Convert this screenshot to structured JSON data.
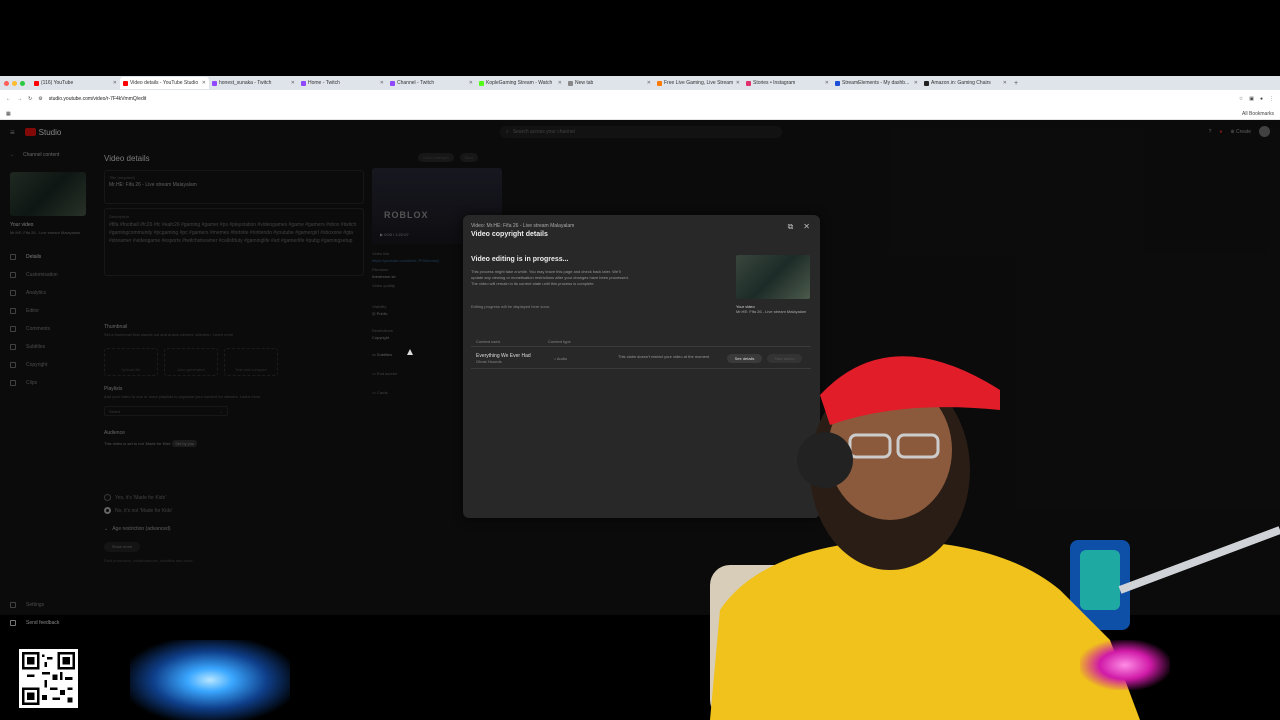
{
  "browser": {
    "tabs": [
      {
        "title": "(116) YouTube",
        "color": "#ff0000",
        "active": false
      },
      {
        "title": "Video details - YouTube Studio",
        "color": "#ff0000",
        "active": true
      },
      {
        "title": "honest_sunaka - Twitch",
        "color": "#9146ff",
        "active": false
      },
      {
        "title": "Home - Twitch",
        "color": "#9146ff",
        "active": false
      },
      {
        "title": "Channel - Twitch",
        "color": "#9146ff",
        "active": false
      },
      {
        "title": "KopleGaming Stream - Watch",
        "color": "#53fc18",
        "active": false
      },
      {
        "title": "New tab",
        "color": "#888888",
        "active": false
      },
      {
        "title": "Free Live Gaming, Live Stream",
        "color": "#ff7a00",
        "active": false
      },
      {
        "title": "Stories • Instagram",
        "color": "#e1306c",
        "active": false
      },
      {
        "title": "StreamElements - My dashb...",
        "color": "#1d4ed8",
        "active": false
      },
      {
        "title": "Amazon.in: Gaming Chairs",
        "color": "#222222",
        "active": false
      }
    ],
    "url": "studio.youtube.com/video/r-7F4kVmmQ/edit",
    "bookmarks_label": "All Bookmarks"
  },
  "studio": {
    "logo": "Studio",
    "search_placeholder": "Search across your channel",
    "create_label": "Create",
    "back_label": "Channel content",
    "your_video": "Your video",
    "video_name": "Mr.HE: Fifa 26 - Live stream Malayalam",
    "nav": [
      "Details",
      "Customisation",
      "Analytics",
      "Editor",
      "Comments",
      "Subtitles",
      "Copyright",
      "Clips"
    ],
    "bottom_nav": [
      "Settings",
      "Send feedback"
    ],
    "page_title": "Video details",
    "undo_label": "Undo changes",
    "save_label": "Save",
    "title_label": "Title (required)",
    "title_value": "Mr.HE: Fifa 26 - Live stream Malayalam",
    "desc_label": "Description",
    "desc_value": "#fifa #football #fc26 #fc #eafc26 #gaming #gamer #ps #playstation #videogames #game #gamers #xbox #twitch #gamingcommunity #pcgaming #pc #gamers #memes #fortnite #nintendo #youtube #gamergirl #xboxone #gta #streamer #videogame #esports #twitchstreamer #callofduty #gaminglife #art #gamerlife #pubg #gamingsetup",
    "thumbnail_h": "Thumbnail",
    "thumbnail_desc": "Set a thumbnail that stands out and draws viewers' attention. Learn more",
    "thumb_options": [
      "Upload file",
      "Auto-generated",
      "Test and compare"
    ],
    "playlists_h": "Playlists",
    "playlists_desc": "Add your video to one or more playlists to organise your content for viewers. Learn more",
    "select_label": "Select",
    "audience_h": "Audience",
    "audience_line": "This video is set to not 'Made for Kids'",
    "audience_badge": "Set by you",
    "radio_yes": "Yes, it's 'Made for Kids'",
    "radio_no": "No, it's not 'Made for Kids'",
    "age_restriction": "Age restriction (advanced)",
    "show_more": "Show more",
    "show_more_desc": "Paid promotion, collaborations, subtitles and more",
    "rp_brand": "ROBLOX",
    "rp_time": "0:00 / 1:22:07",
    "rp_link_label": "Video link",
    "rp_link": "https://youtube.com/live/r-7F4kVmmQ",
    "rp_filename_label": "Filename",
    "rp_filename": "livestream.str",
    "rp_quality_label": "Video quality",
    "rp_visibility_label": "Visibility",
    "rp_visibility": "Public",
    "rp_restrictions_label": "Restrictions",
    "rp_restrictions": "Copyright",
    "rp_subtitles": "Subtitles",
    "rp_endscreen": "End screen",
    "rp_cards": "Cards"
  },
  "modal": {
    "subtitle": "Video: Mr.HE: Fifa 26 - Live stream Malayalam",
    "title": "Video copyright details",
    "heading": "Video editing is in progress...",
    "body": "This process might take a while. You may leave this page and check back later. We'll update any viewing or monetisation restrictions after your changes have been processed. The video will remain in its current state until this process is complete.",
    "body2": "Editing progress will be displayed here soon.",
    "your_video_label": "Your video",
    "your_video_title": "Mr.HE: Fifa 26 - Live stream Malayalam",
    "col_content": "Content used",
    "col_type": "Content type",
    "row": {
      "song": "Everything We Ever Had",
      "artist": "Ghost Hounds",
      "type": "Audio",
      "status": "This claim doesn't restrict your video at the moment",
      "btn1": "See details",
      "btn2": "Take action"
    }
  }
}
